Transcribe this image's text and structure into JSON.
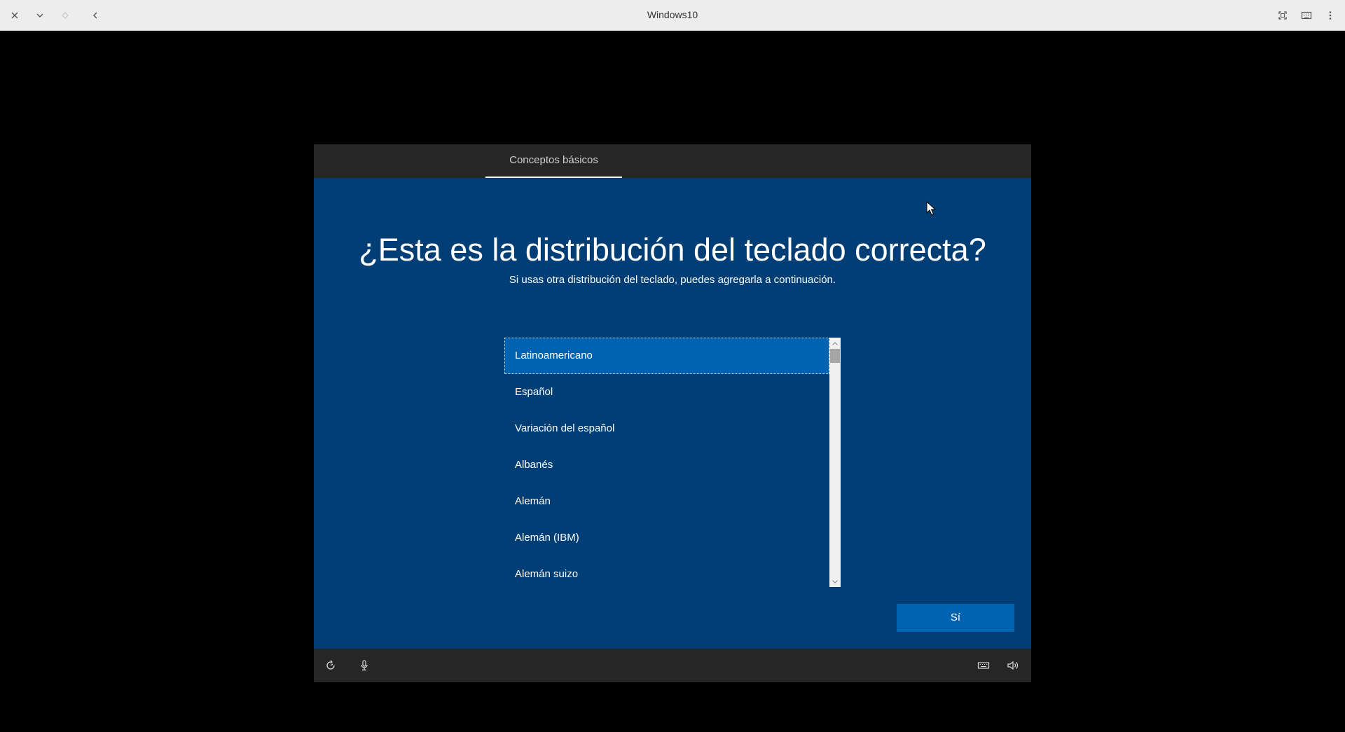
{
  "window": {
    "title": "Windows10"
  },
  "toolbar": {
    "left_icons": [
      "close-icon",
      "chevron-down-icon",
      "diamond-icon",
      "back-arrow-icon"
    ],
    "right_icons": [
      "fullscreen-icon",
      "keyboard-input-icon",
      "more-vertical-icon"
    ]
  },
  "oobe": {
    "tab_label": "Conceptos básicos",
    "title": "¿Esta es la distribución del teclado correcta?",
    "subtitle": "Si usas otra distribución del teclado, puedes agregarla a continuación.",
    "keyboard_layouts": [
      "Latinoamericano",
      "Español",
      "Variación del español",
      "Albanés",
      "Alemán",
      "Alemán (IBM)",
      "Alemán suizo"
    ],
    "selected_index": 0,
    "yes_button": "Sí",
    "footer_left_icons": [
      "ease-of-access-icon",
      "microphone-icon"
    ],
    "footer_right_icons": [
      "keyboard-icon",
      "volume-icon"
    ]
  },
  "colors": {
    "oobe_background": "#003e75",
    "accent": "#0063b1",
    "header_footer": "#262626"
  }
}
